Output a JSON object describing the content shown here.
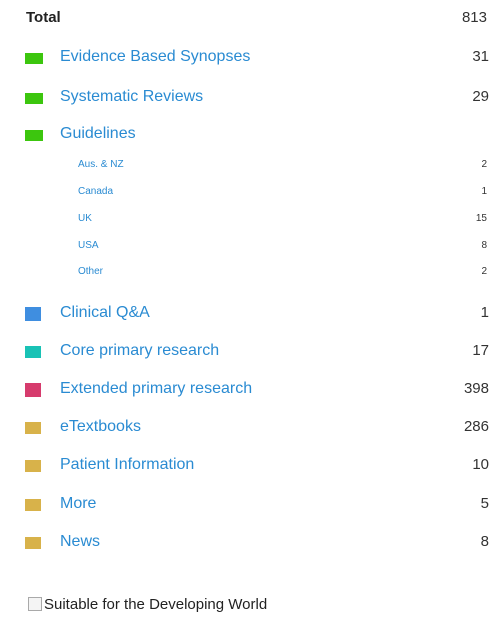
{
  "total": {
    "label": "Total",
    "count": "813"
  },
  "categories": [
    {
      "label": "Evidence Based Synopses",
      "count": "31",
      "color": "#3cc60e"
    },
    {
      "label": "Systematic Reviews",
      "count": "29",
      "color": "#3cc60e"
    },
    {
      "label": "Guidelines",
      "count": "",
      "color": "#3cc60e"
    },
    {
      "label": "Clinical Q&A",
      "count": "1",
      "color": "#3f8ee0"
    },
    {
      "label": "Core primary research",
      "count": "17",
      "color": "#19c2b5"
    },
    {
      "label": "Extended primary research",
      "count": "398",
      "color": "#d63b6d"
    },
    {
      "label": "eTextbooks",
      "count": "286",
      "color": "#d8b24a"
    },
    {
      "label": "Patient Information",
      "count": "10",
      "color": "#d8b24a"
    },
    {
      "label": "More",
      "count": "5",
      "color": "#d8b24a"
    },
    {
      "label": "News",
      "count": "8",
      "color": "#d8b24a"
    }
  ],
  "guidelines_sub": [
    {
      "label": "Aus. & NZ",
      "count": "2"
    },
    {
      "label": "Canada",
      "count": "1"
    },
    {
      "label": "UK",
      "count": "15"
    },
    {
      "label": "USA",
      "count": "8"
    },
    {
      "label": "Other",
      "count": "2"
    }
  ],
  "filter": {
    "label": "Suitable for the Developing World",
    "checked": false
  }
}
